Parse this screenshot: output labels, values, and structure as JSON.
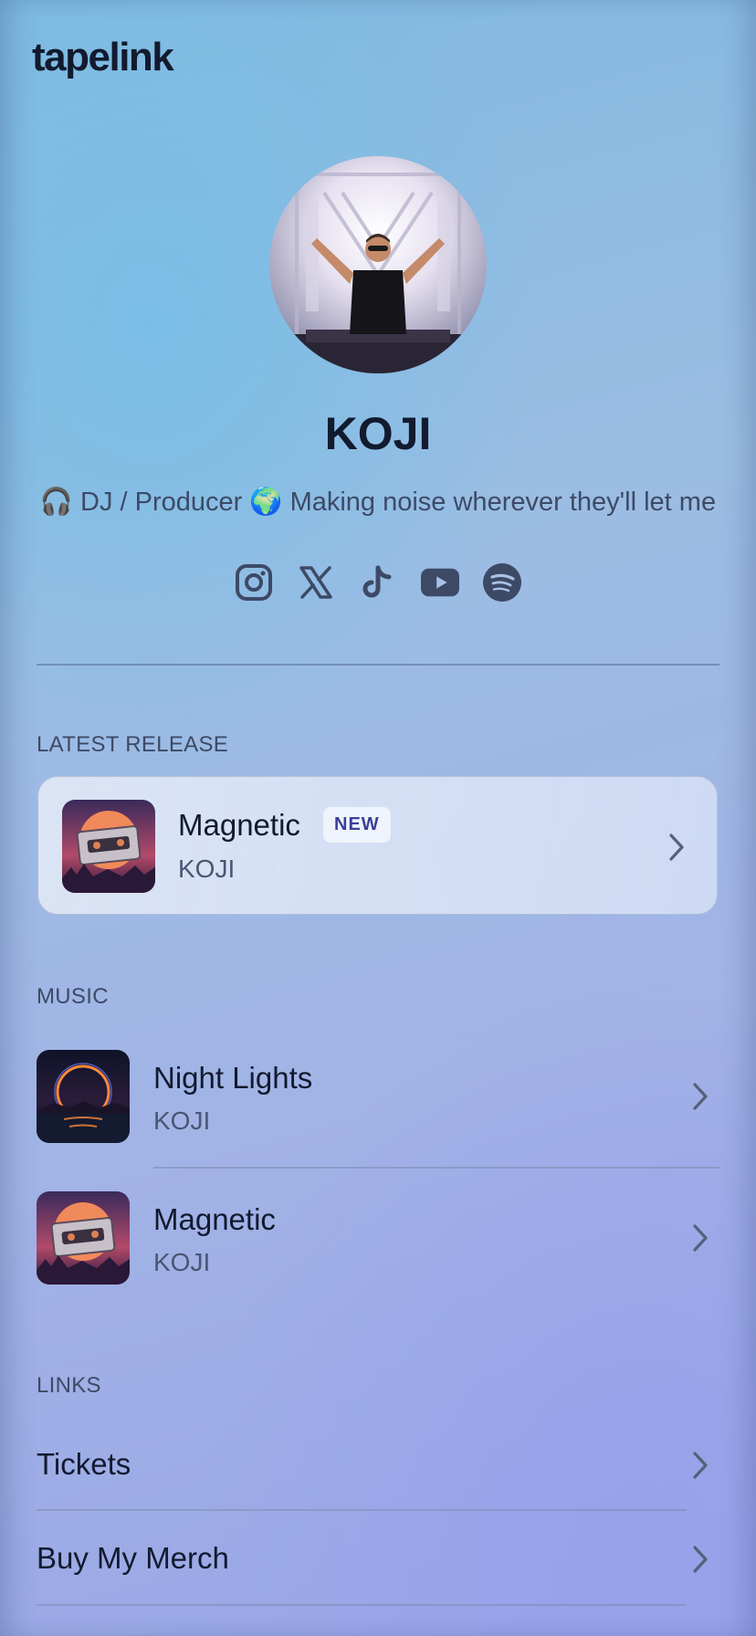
{
  "app": {
    "logo": "tapelink"
  },
  "profile": {
    "name": "KOJI",
    "bio": "🎧 DJ / Producer 🌍 Making noise wherever they'll let me"
  },
  "social_icons": [
    "instagram-icon",
    "x-icon",
    "tiktok-icon",
    "youtube-icon",
    "spotify-icon"
  ],
  "latest_release": {
    "section_label": "LATEST RELEASE",
    "title": "Magnetic",
    "badge": "NEW",
    "artist": "KOJI"
  },
  "music": {
    "section_label": "MUSIC",
    "items": [
      {
        "title": "Night Lights",
        "artist": "KOJI"
      },
      {
        "title": "Magnetic",
        "artist": "KOJI"
      }
    ]
  },
  "links": {
    "section_label": "LINKS",
    "items": [
      {
        "label": "Tickets"
      },
      {
        "label": "Buy My Merch"
      }
    ]
  },
  "colors": {
    "text_primary": "#121a2e",
    "text_secondary": "#3d4a66",
    "badge_text": "#3a3f9a"
  }
}
